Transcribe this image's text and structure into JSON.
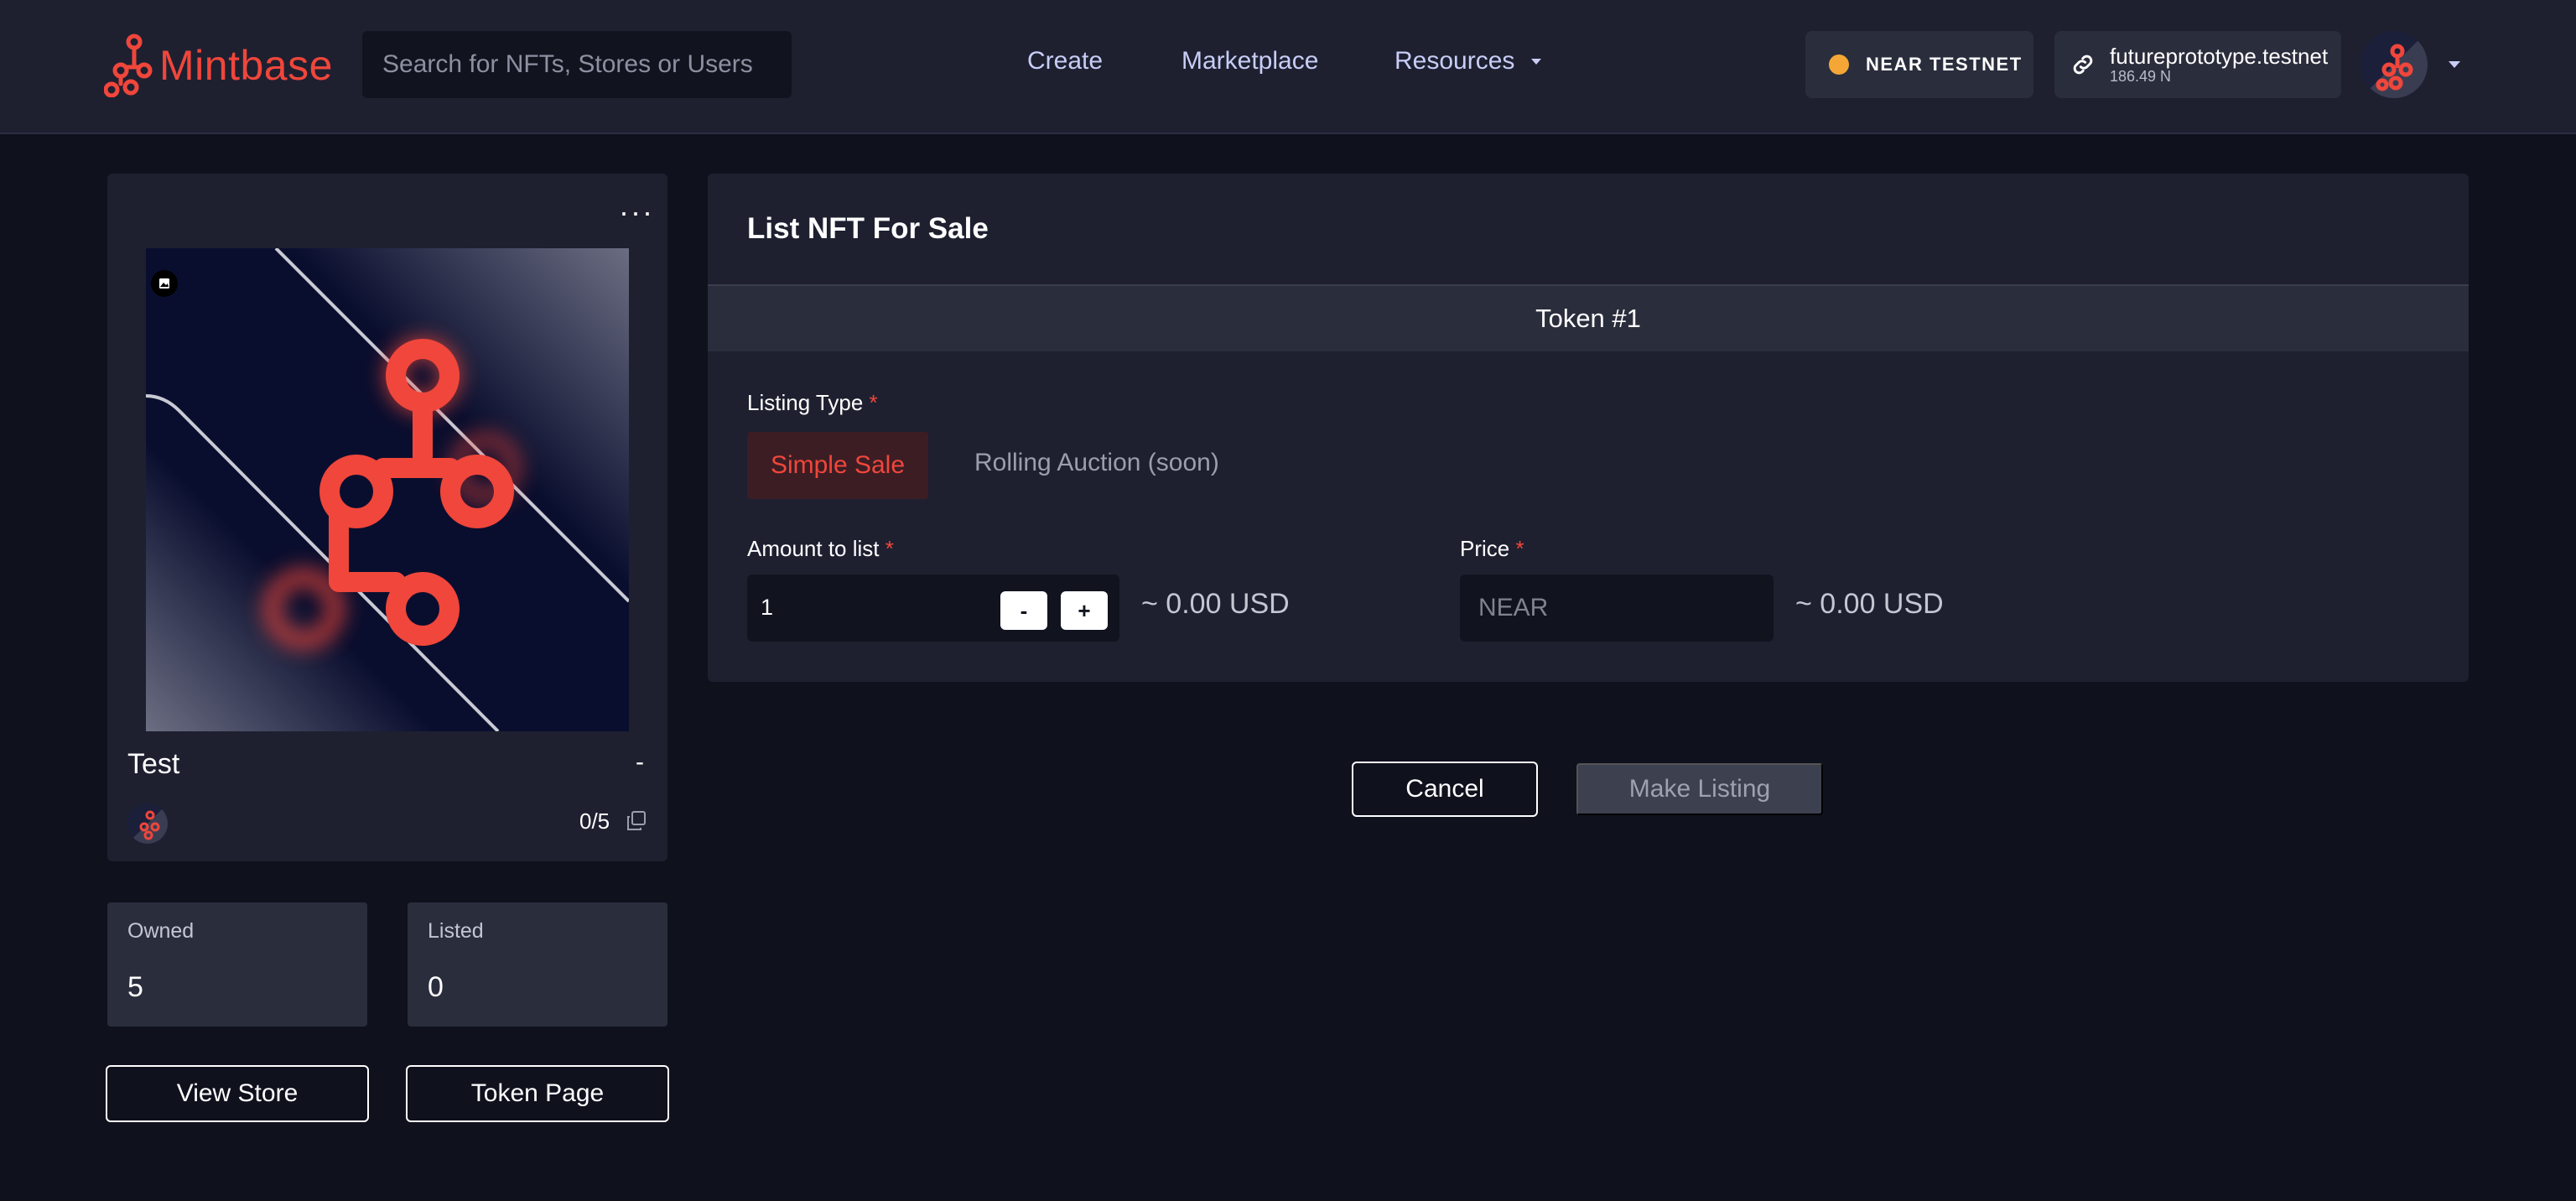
{
  "header": {
    "logo_text": "Mintbase",
    "search_placeholder": "Search for NFTs, Stores or Users",
    "nav": {
      "create": "Create",
      "marketplace": "Marketplace",
      "resources": "Resources"
    },
    "network_label": "NEAR TESTNET",
    "account_name": "futureprototype.testnet",
    "account_balance": "186.49 N"
  },
  "nft_card": {
    "title": "Test",
    "price_dash": "-",
    "count": "0/5"
  },
  "stats": {
    "owned_label": "Owned",
    "owned_value": "5",
    "listed_label": "Listed",
    "listed_value": "0"
  },
  "actions": {
    "view_store": "View Store",
    "token_page": "Token Page"
  },
  "listing": {
    "title": "List NFT For Sale",
    "token": "Token #1",
    "listing_type_label": "Listing Type",
    "required_mark": "*",
    "tabs": {
      "simple_sale": "Simple Sale",
      "rolling_auction": "Rolling Auction (soon)"
    },
    "amount_label": "Amount to list",
    "amount_value": "1",
    "minus": "-",
    "plus": "+",
    "amount_usd": "~ 0.00 USD",
    "price_label": "Price",
    "price_placeholder": "NEAR",
    "price_usd": "~ 0.00 USD",
    "cancel": "Cancel",
    "make_listing": "Make Listing"
  },
  "colors": {
    "brand": "#f0463b",
    "background": "#0f111d",
    "panel": "#1e2030",
    "network_dot": "#f4a736"
  },
  "icons": {
    "logo": "mintbase-logo-icon",
    "link": "link-icon",
    "more": "more-dots-icon",
    "image_badge": "image-icon",
    "copy": "copy-icon"
  }
}
